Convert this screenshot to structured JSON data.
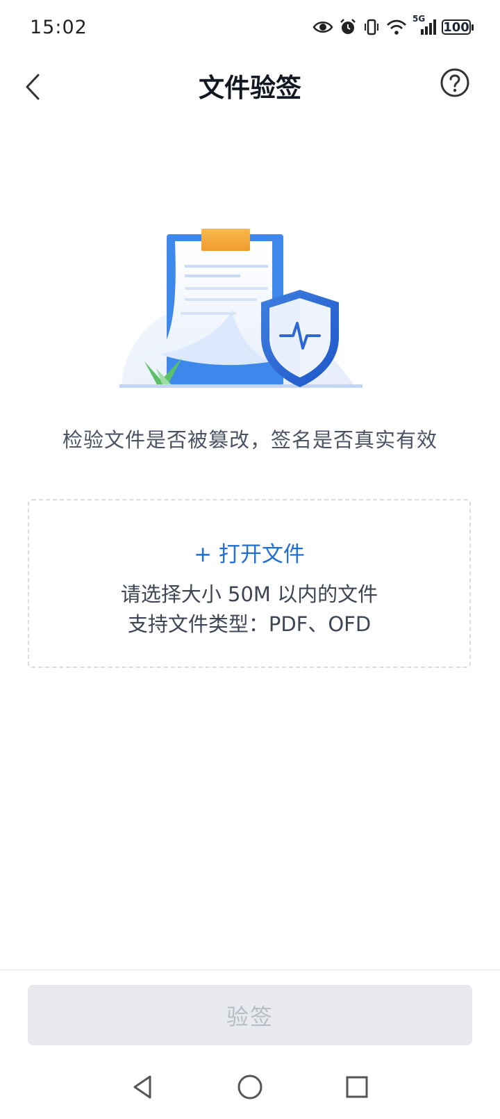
{
  "status_bar": {
    "time": "15:02",
    "network": "5G",
    "battery": "100"
  },
  "header": {
    "title": "文件验签"
  },
  "main": {
    "description": "检验文件是否被篡改，签名是否真实有效",
    "upload": {
      "open_label": "+ 打开文件",
      "size_hint": "请选择大小 50M 以内的文件",
      "type_hint": "支持文件类型：PDF、OFD"
    }
  },
  "footer": {
    "verify_label": "验签"
  },
  "colors": {
    "accent": "#1f6fd6",
    "disabled_bg": "#e9eaee",
    "disabled_text": "#b8bcc6"
  },
  "icons": [
    "eye-icon",
    "alarm-icon",
    "vibrate-icon",
    "wifi-icon",
    "signal-icon",
    "battery-icon",
    "back-arrow-icon",
    "help-icon",
    "system-back-icon",
    "system-home-icon",
    "system-recent-icon"
  ]
}
